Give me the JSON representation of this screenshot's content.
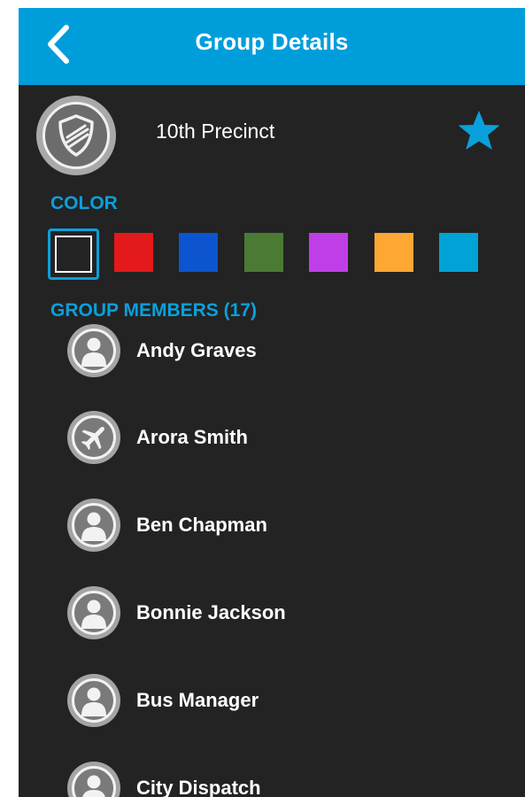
{
  "header": {
    "title": "Group Details",
    "back_icon": "chevron-left-icon",
    "background": "#009ddb"
  },
  "group": {
    "name": "10th Precinct",
    "avatar_icon": "shield-icon",
    "favorite_icon": "star-icon",
    "favorite": true,
    "accent": "#0aa0dc"
  },
  "color_section": {
    "label": "COLOR",
    "selected_index": 0,
    "options": [
      "#232323",
      "#e3191b",
      "#0c55cf",
      "#4b7a34",
      "#c03ee8",
      "#ffa733",
      "#01a3d7"
    ]
  },
  "members_section": {
    "label": "GROUP MEMBERS (17)",
    "members": [
      {
        "name": "Andy Graves",
        "icon": "person-icon"
      },
      {
        "name": "Arora Smith",
        "icon": "airplane-icon"
      },
      {
        "name": "Ben Chapman",
        "icon": "person-icon"
      },
      {
        "name": "Bonnie Jackson",
        "icon": "person-icon"
      },
      {
        "name": "Bus Manager",
        "icon": "person-icon"
      },
      {
        "name": "City Dispatch",
        "icon": "person-icon"
      }
    ]
  }
}
